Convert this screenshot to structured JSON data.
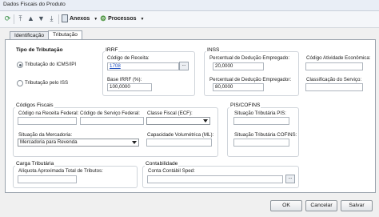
{
  "window": {
    "title": "Dados Fiscais do Produto"
  },
  "toolbar": {
    "anexos_label": "Anexos",
    "processos_label": "Processos"
  },
  "tabs": [
    {
      "label": "Identificação",
      "active": false
    },
    {
      "label": "Tributação",
      "active": true
    }
  ],
  "tipo_tributacao": {
    "title": "Tipo de Tributação",
    "options": [
      {
        "label": "Tributação do ICMS/IPI",
        "selected": true
      },
      {
        "label": "Tributação pelo ISS",
        "selected": false
      }
    ]
  },
  "irrf": {
    "title": "IRRF",
    "codigo_receita_label": "Código de Receita:",
    "codigo_receita_value": "1708",
    "base_label": "Base IRRF (%):",
    "base_value": "100,0000"
  },
  "inss": {
    "title": "INSS",
    "perc_empregado_label": "Percentual de Dedução Empregado:",
    "perc_empregado_value": "20,0000",
    "perc_empregador_label": "Percentual de Dedução Empregador:",
    "perc_empregador_value": "80,0000",
    "atividade_label": "Código Atividade Econômica:",
    "classificacao_label": "Classificação do Serviço:"
  },
  "codigos_fiscais": {
    "title": "Códigos Fiscais",
    "ncm_label": "Código na Receita Federal:",
    "servico_label": "Código de Serviço Federal:",
    "classe_label": "Classe Fiscal (ECF):",
    "situacao_label": "Situação da Mercadoria:",
    "situacao_value": "Mercadoria para Revenda",
    "capacidade_label": "Capacidade Volumétrica (ML):"
  },
  "pis_cofins": {
    "title": "PIS/COFINS",
    "pis_label": "Situação Tributária PIS:",
    "cofins_label": "Situação Tributária COFINS:"
  },
  "carga": {
    "title": "Carga Tributária",
    "aliquota_label": "Alíquota Aproximada Total de Tributos:"
  },
  "contabilidade": {
    "title": "Contabilidade",
    "conta_label": "Conta Contábil Sped:"
  },
  "footer": {
    "ok_label": "OK",
    "cancelar_label": "Cancelar",
    "salvar_label": "Salvar"
  }
}
